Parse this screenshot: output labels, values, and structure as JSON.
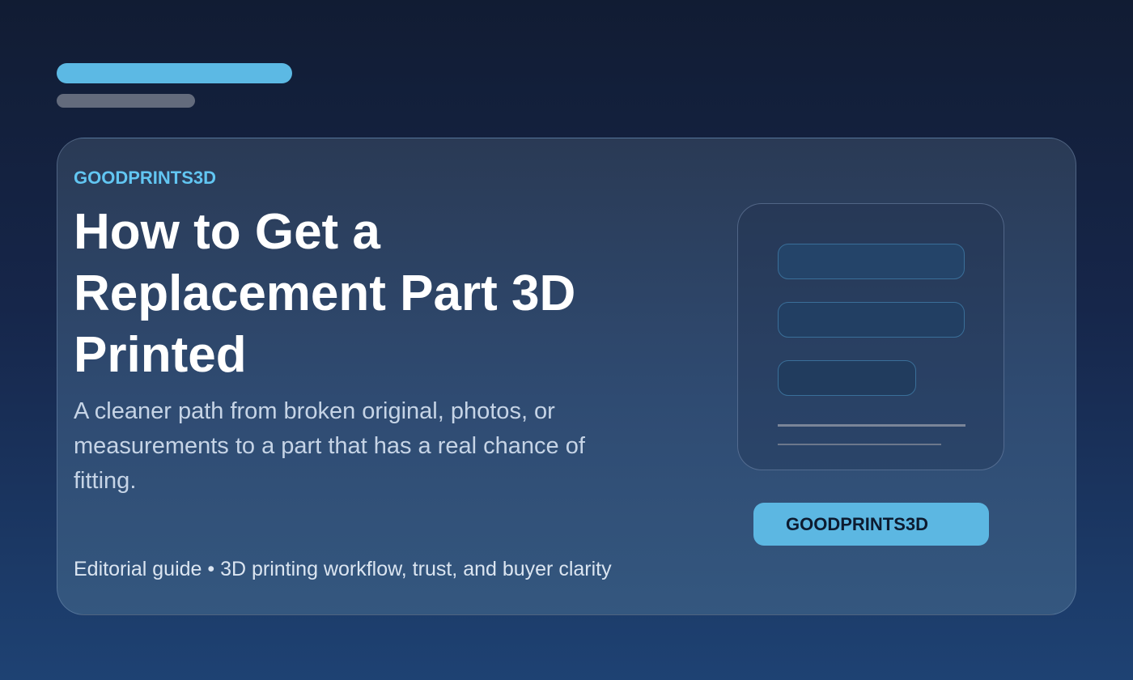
{
  "header": {
    "decor": [
      "accent-bar",
      "muted-bar"
    ]
  },
  "card": {
    "brand": "GOODPRINTS3D",
    "headline": "How to Get a Replacement Part 3D Printed",
    "subtitle": "A cleaner path from broken original, photos, or measurements to a part that has a real chance of fitting.",
    "footer": "Editorial guide • 3D printing workflow, trust, and buyer clarity",
    "button_label": "GOODPRINTS3D"
  },
  "colors": {
    "accent": "#5cb9e4",
    "brand_label": "#62c6f2",
    "background_top": "#111c33",
    "background_bottom": "#1e4273",
    "card_top": "#2a3a55",
    "card_bottom": "#34577f"
  }
}
